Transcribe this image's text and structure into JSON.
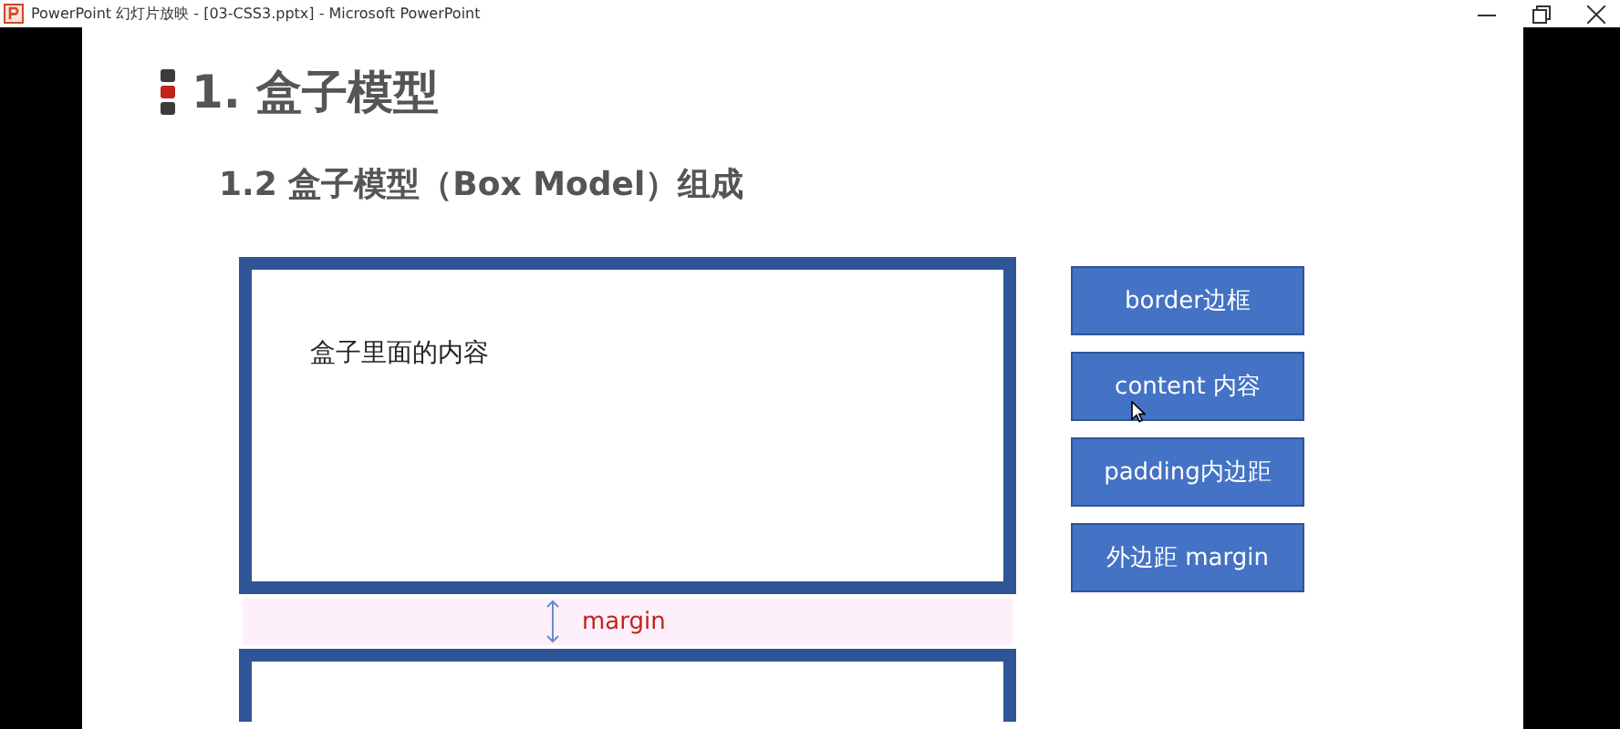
{
  "window": {
    "title": "PowerPoint 幻灯片放映 - [03-CSS3.pptx] - Microsoft PowerPoint"
  },
  "slide": {
    "title": "1. 盒子模型",
    "subtitle": "1.2 盒子模型（Box Model）组成",
    "box_content": "盒子里面的内容",
    "margin_label": "margin",
    "legend": [
      "border边框",
      "content 内容",
      "padding内边距",
      "外边距 margin"
    ]
  }
}
